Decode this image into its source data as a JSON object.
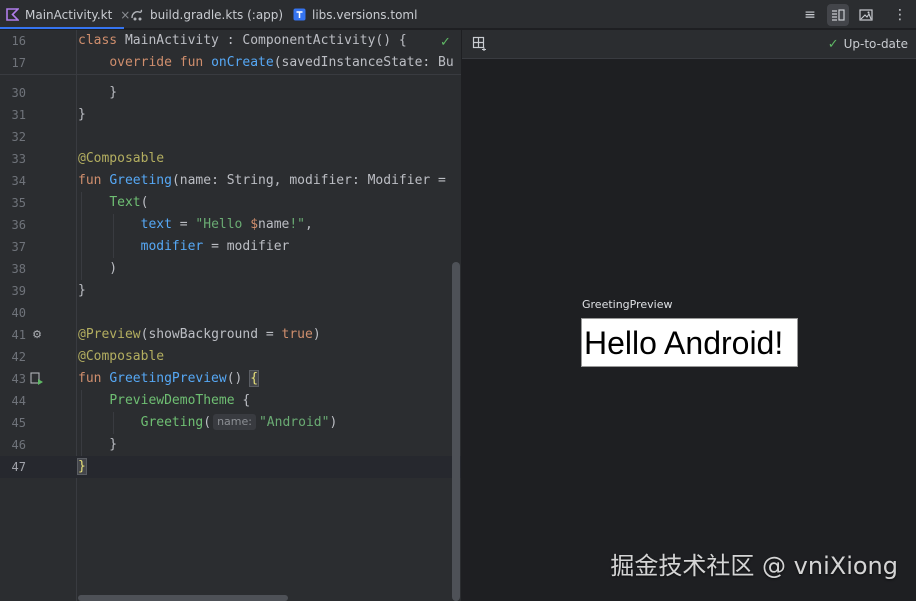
{
  "tabs": [
    {
      "label": "MainActivity.kt",
      "icon": "kotlin-file-icon",
      "active": true
    },
    {
      "label": "build.gradle.kts (:app)",
      "icon": "gradle-file-icon",
      "active": false
    },
    {
      "label": "libs.versions.toml",
      "icon": "toml-file-icon",
      "active": false
    }
  ],
  "toolbar": {
    "code_view_icon": "≡",
    "split_view_icon": "split",
    "design_view_icon": "image",
    "more_icon": "⋮"
  },
  "editor": {
    "lines": [
      {
        "num": "16",
        "code": "class MainActivity : ComponentActivity() {"
      },
      {
        "num": "17",
        "code": "override fun onCreate(savedInstanceState: Bu"
      },
      {
        "num": "30",
        "code": "}"
      },
      {
        "num": "31",
        "code": "}"
      },
      {
        "num": "32",
        "code": ""
      },
      {
        "num": "33",
        "code": "@Composable"
      },
      {
        "num": "34",
        "code": "fun Greeting(name: String, modifier: Modifier ="
      },
      {
        "num": "35",
        "code": "Text("
      },
      {
        "num": "36",
        "code": "text = \"Hello $name!\","
      },
      {
        "num": "37",
        "code": "modifier = modifier"
      },
      {
        "num": "38",
        "code": ")"
      },
      {
        "num": "39",
        "code": "}"
      },
      {
        "num": "40",
        "code": ""
      },
      {
        "num": "41",
        "code": "@Preview(showBackground = true)"
      },
      {
        "num": "42",
        "code": "@Composable"
      },
      {
        "num": "43",
        "code": "fun GreetingPreview() {"
      },
      {
        "num": "44",
        "code": "PreviewDemoTheme {"
      },
      {
        "num": "45",
        "code": "Greeting( name: \"Android\")"
      },
      {
        "num": "46",
        "code": "}"
      },
      {
        "num": "47",
        "code": "}"
      }
    ],
    "inlay_hint": "name:"
  },
  "preview": {
    "status": "Up-to-date",
    "preview_name": "GreetingPreview",
    "rendered_text": "Hello Android!"
  },
  "watermark": "掘金技术社区 @ vniXiong",
  "colors": {
    "editor_bg": "#2b2d30",
    "preview_bg": "#1e1f22",
    "keyword": "#cf8e6d",
    "annotation": "#b3ae60",
    "function": "#56a8f5",
    "string": "#6aab73",
    "accent": "#3574f0"
  }
}
